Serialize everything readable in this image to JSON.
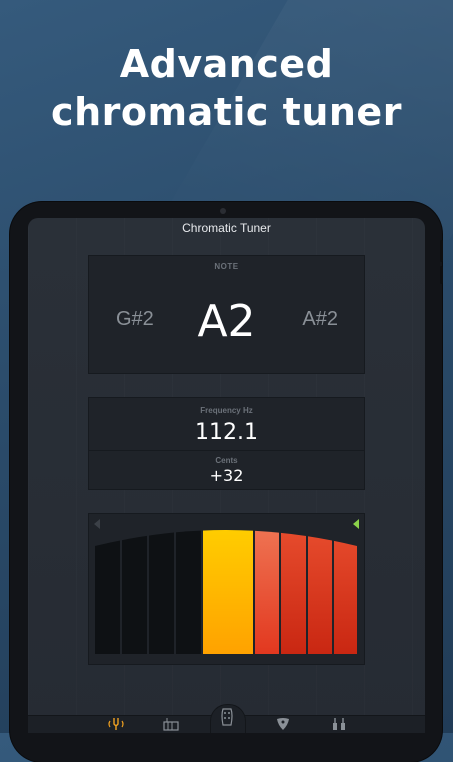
{
  "headline": {
    "line1": "Advanced",
    "line2": "chromatic tuner"
  },
  "screen": {
    "title": "Chromatic Tuner"
  },
  "note": {
    "label": "NOTE",
    "previous": "G#2",
    "current": "A2",
    "next": "A#2"
  },
  "frequency": {
    "label": "Frequency Hz",
    "value": "112.1"
  },
  "cents": {
    "label": "Cents",
    "value": "+32"
  },
  "meter": {
    "colors": {
      "off": "#0e1114",
      "center": "#ffc400",
      "sharp": "#e5452a",
      "sharp_light": "#ef6a48"
    },
    "indicators": {
      "flat_arrow": "dim-left-triangle",
      "sharp_arrow": "green-left-triangle"
    }
  },
  "tabs": [
    {
      "name": "tuner-tab",
      "icon": "tuning-fork-icon",
      "active": true
    },
    {
      "name": "keyboard-tab",
      "icon": "keyboard-icon",
      "active": false
    },
    {
      "name": "instrument-tab",
      "icon": "guitar-headstock-icon",
      "active": false
    },
    {
      "name": "pick-tab",
      "icon": "guitar-pick-icon",
      "active": false
    },
    {
      "name": "settings-tab",
      "icon": "pegs-icon",
      "active": false
    }
  ]
}
